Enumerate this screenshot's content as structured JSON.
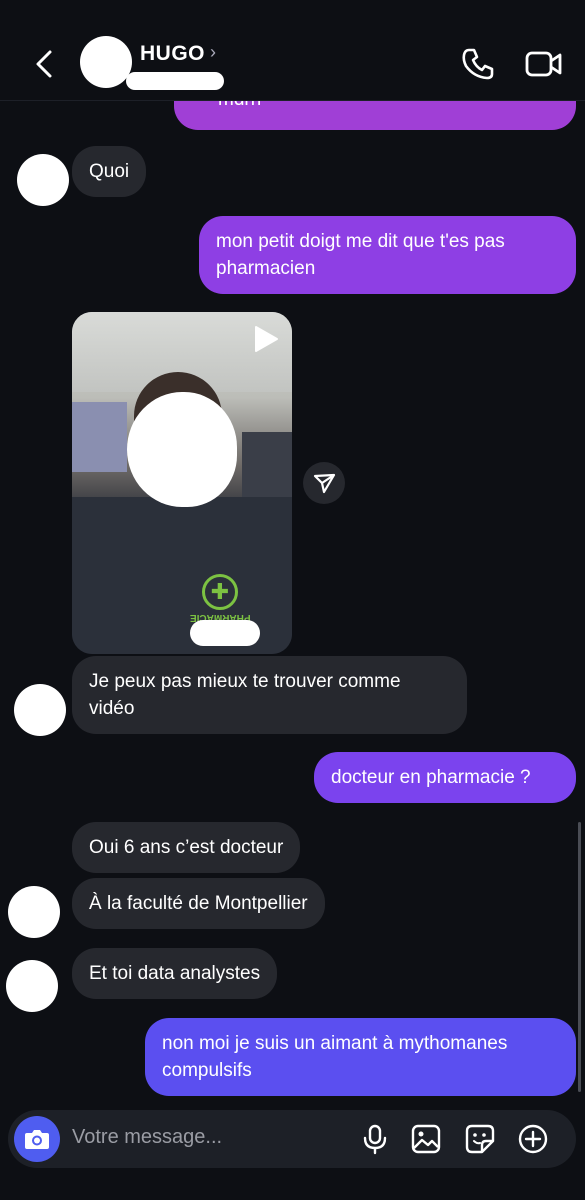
{
  "header": {
    "contact_name": "HUGO",
    "chevron": "›",
    "icons": {
      "back": "back-icon",
      "call": "phone-icon",
      "video": "video-camera-icon"
    }
  },
  "messages": [
    {
      "id": "m0",
      "direction": "out",
      "text": "mdrrr",
      "color": "#a03fd6"
    },
    {
      "id": "m1",
      "direction": "in",
      "text": "Quoi"
    },
    {
      "id": "m2",
      "direction": "out",
      "text": "mon petit doigt me dit que t'es pas pharmacien",
      "color": "#8e3fe4"
    },
    {
      "id": "m3",
      "direction": "in",
      "type": "video"
    },
    {
      "id": "m4",
      "direction": "in",
      "text": "Je peux pas mieux te trouver comme vidéo"
    },
    {
      "id": "m5",
      "direction": "out",
      "text": "docteur en pharmacie ?",
      "color": "#7b43ee"
    },
    {
      "id": "m6",
      "direction": "in",
      "text": "Oui 6 ans c’est docteur"
    },
    {
      "id": "m7",
      "direction": "in",
      "text": "À la faculté de Montpellier"
    },
    {
      "id": "m8",
      "direction": "in",
      "text": "Et toi data analystes"
    },
    {
      "id": "m9",
      "direction": "out",
      "text": "non moi je suis un aimant à mythomanes compulsifs",
      "color": "#5b4ff0"
    }
  ],
  "video": {
    "logo_symbol": "✚",
    "logo_text": "PHARMACIE"
  },
  "composer": {
    "placeholder": "Votre message...",
    "icons": [
      "camera-icon",
      "microphone-icon",
      "gallery-icon",
      "sticker-icon",
      "add-icon"
    ]
  },
  "colors": {
    "background": "#0d0f14",
    "incoming_bubble": "#26282e",
    "camera_button": "#4f5df0"
  }
}
